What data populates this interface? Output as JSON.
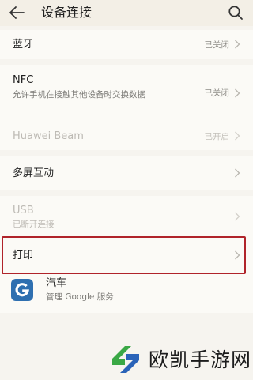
{
  "header": {
    "title": "设备连接",
    "back_icon": "arrow-left-icon",
    "search_icon": "search-icon"
  },
  "items": {
    "bluetooth": {
      "label": "蓝牙",
      "status": "已关闭"
    },
    "nfc": {
      "label": "NFC",
      "description": "允许手机在接触其他设备时交换数据",
      "status": "已关闭"
    },
    "huawei_beam": {
      "label": "Huawei Beam",
      "status": "已开启"
    },
    "multiscreen": {
      "label": "多屏互动"
    },
    "usb": {
      "label": "USB",
      "status": "已断开连接"
    },
    "print": {
      "label": "打印"
    },
    "auto": {
      "label": "汽车",
      "description": "管理 Google 服务"
    }
  },
  "watermark": {
    "text": "欧凯手游网"
  },
  "colors": {
    "background": "#f6f4ef",
    "card": "#fbfaf6",
    "highlight_border": "#b0232a",
    "google_icon_bg": "#2e6fb0",
    "watermark_green": "#3aa845",
    "watermark_blue": "#2a63b8"
  }
}
